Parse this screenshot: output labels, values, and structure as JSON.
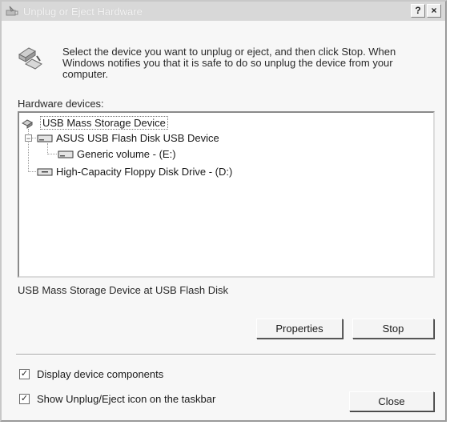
{
  "window": {
    "title": "Unplug or Eject Hardware",
    "help_label": "?",
    "close_label": "×"
  },
  "instructions": "Select the device you want to unplug or eject, and then click Stop. When Windows notifies you that it is safe to do so unplug the device from your computer.",
  "hardware_devices_label": "Hardware devices:",
  "tree": [
    {
      "label": "USB Mass Storage Device",
      "icon": "usb-device-icon"
    },
    {
      "label": "ASUS USB Flash Disk USB Device",
      "icon": "drive-icon"
    },
    {
      "label": "Generic volume - (E:)",
      "icon": "volume-icon"
    },
    {
      "label": "High-Capacity Floppy Disk Drive - (D:)",
      "icon": "floppy-drive-icon"
    }
  ],
  "status_text": "USB Mass Storage Device at USB Flash Disk",
  "buttons": {
    "properties": "Properties",
    "stop": "Stop",
    "close": "Close"
  },
  "options": {
    "display_components": {
      "label": "Display device components",
      "checked": true
    },
    "show_icon": {
      "label": "Show Unplug/Eject icon on the taskbar",
      "checked": true
    }
  }
}
